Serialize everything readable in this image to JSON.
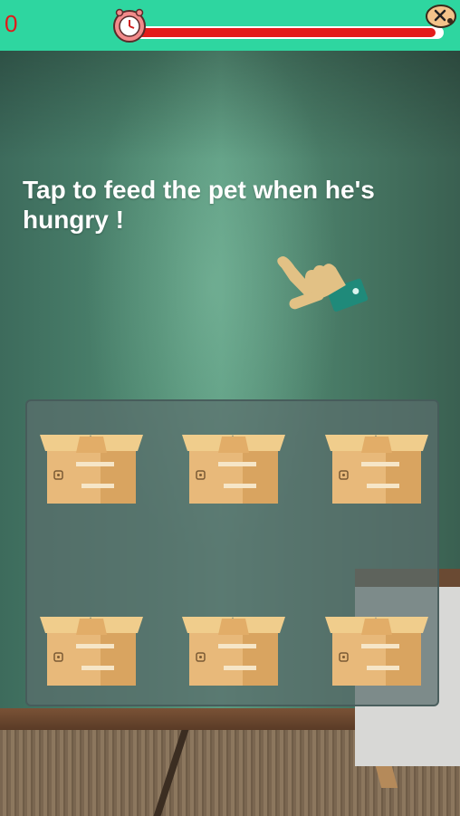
{
  "hud": {
    "score": "0",
    "timer_fraction": 0.98,
    "timer_color": "#e41b1b",
    "topbar_color": "#2ed6a0",
    "clock_icon": "alarm-clock-icon",
    "close_icon": "close-icon"
  },
  "instruction": {
    "text": "Tap to feed the pet when he's hungry !"
  },
  "hint": {
    "icon": "pointing-hand-icon"
  },
  "boxes": [
    {
      "id": 1,
      "icon": "cardboard-box-icon"
    },
    {
      "id": 2,
      "icon": "cardboard-box-icon"
    },
    {
      "id": 3,
      "icon": "cardboard-box-icon"
    },
    {
      "id": 4,
      "icon": "cardboard-box-icon"
    },
    {
      "id": 5,
      "icon": "cardboard-box-icon"
    },
    {
      "id": 6,
      "icon": "cardboard-box-icon"
    }
  ]
}
